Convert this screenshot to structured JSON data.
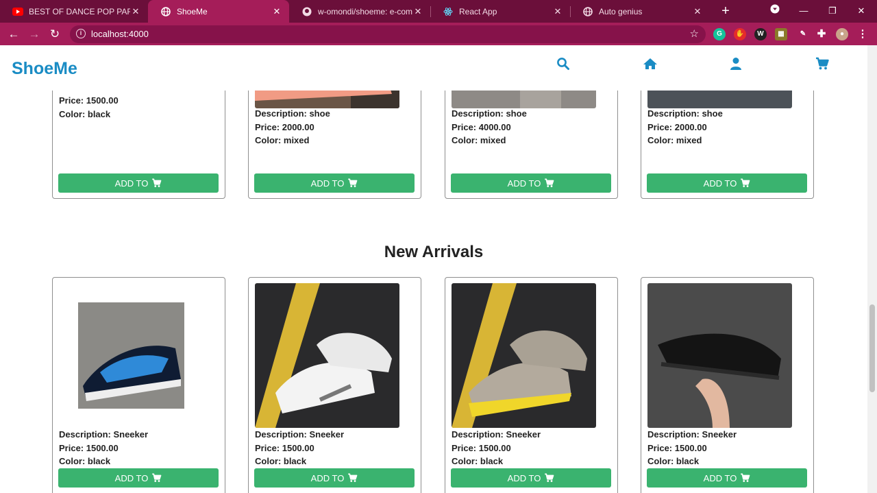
{
  "browser": {
    "tabs": [
      {
        "title": "BEST OF DANCE POP PARTY MIX",
        "icon": "youtube-icon"
      },
      {
        "title": "ShoeMe",
        "icon": "globe-icon"
      },
      {
        "title": "w-omondi/shoeme: e-commerce",
        "icon": "github-icon"
      },
      {
        "title": "React App",
        "icon": "react-icon"
      },
      {
        "title": "Auto genius",
        "icon": "globe-icon"
      }
    ],
    "url": "localhost:4000",
    "accent": "#a51d59"
  },
  "site": {
    "brand": "ShoeMe",
    "nav_icons": [
      "search-icon",
      "home-icon",
      "user-icon",
      "cart-icon"
    ],
    "accent": "#1a8cc4",
    "button_color": "#3ab36f"
  },
  "top_row": {
    "cards": [
      {
        "lines": [
          "Price: 1500.00",
          "Color: black"
        ],
        "button": "ADD TO"
      },
      {
        "lines": [
          "Description: shoe",
          "Price: 2000.00",
          "Color: mixed"
        ],
        "button": "ADD TO"
      },
      {
        "lines": [
          "Description: shoe",
          "Price: 4000.00",
          "Color: mixed"
        ],
        "button": "ADD TO"
      },
      {
        "lines": [
          "Description: shoe",
          "Price: 2000.00",
          "Color: mixed"
        ],
        "button": "ADD TO"
      }
    ]
  },
  "new_arrivals": {
    "title": "New Arrivals",
    "cards": [
      {
        "lines": [
          "Description: Sneeker",
          "Price: 1500.00",
          "Color: black"
        ],
        "button": "ADD TO"
      },
      {
        "lines": [
          "Description: Sneeker",
          "Price: 1500.00",
          "Color: black"
        ],
        "button": "ADD TO"
      },
      {
        "lines": [
          "Description: Sneeker",
          "Price: 1500.00",
          "Color: black"
        ],
        "button": "ADD TO"
      },
      {
        "lines": [
          "Description: Sneeker",
          "Price: 1500.00",
          "Color: black"
        ],
        "button": "ADD TO"
      }
    ]
  }
}
